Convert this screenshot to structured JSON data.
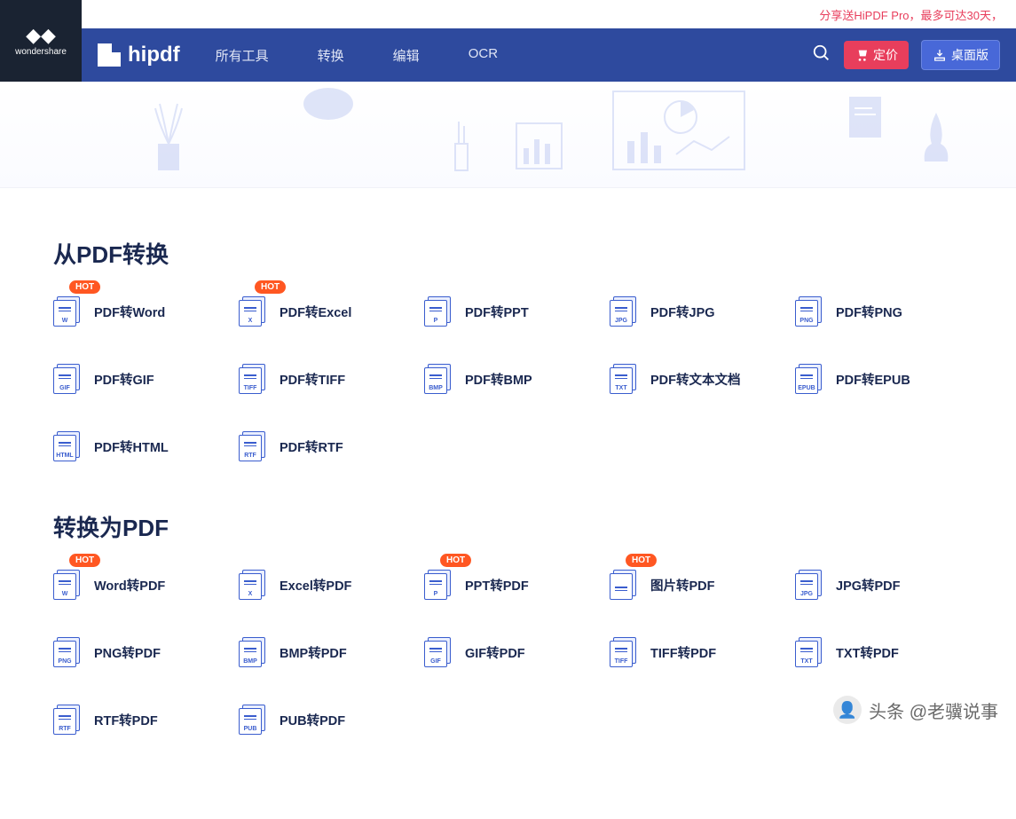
{
  "promo": "分享送HiPDF Pro，最多可达30天，",
  "brand": {
    "wondershare": "wondershare",
    "name": "hipdf"
  },
  "nav": {
    "links": [
      "所有工具",
      "转换",
      "编辑",
      "OCR"
    ],
    "pricing": "定价",
    "desktop": "桌面版"
  },
  "sections": [
    {
      "title": "从PDF转换",
      "tools": [
        {
          "label": "PDF转Word",
          "tag": "W",
          "hot": true
        },
        {
          "label": "PDF转Excel",
          "tag": "X",
          "hot": true
        },
        {
          "label": "PDF转PPT",
          "tag": "P",
          "hot": false
        },
        {
          "label": "PDF转JPG",
          "tag": "JPG",
          "hot": false
        },
        {
          "label": "PDF转PNG",
          "tag": "PNG",
          "hot": false
        },
        {
          "label": "PDF转GIF",
          "tag": "GIF",
          "hot": false
        },
        {
          "label": "PDF转TIFF",
          "tag": "TIFF",
          "hot": false
        },
        {
          "label": "PDF转BMP",
          "tag": "BMP",
          "hot": false
        },
        {
          "label": "PDF转文本文档",
          "tag": "TXT",
          "hot": false
        },
        {
          "label": "PDF转EPUB",
          "tag": "EPUB",
          "hot": false
        },
        {
          "label": "PDF转HTML",
          "tag": "HTML",
          "hot": false
        },
        {
          "label": "PDF转RTF",
          "tag": "RTF",
          "hot": false
        }
      ]
    },
    {
      "title": "转换为PDF",
      "tools": [
        {
          "label": "Word转PDF",
          "tag": "W",
          "hot": true
        },
        {
          "label": "Excel转PDF",
          "tag": "X",
          "hot": false
        },
        {
          "label": "PPT转PDF",
          "tag": "P",
          "hot": true
        },
        {
          "label": "图片转PDF",
          "tag": "",
          "hot": true
        },
        {
          "label": "JPG转PDF",
          "tag": "JPG",
          "hot": false
        },
        {
          "label": "PNG转PDF",
          "tag": "PNG",
          "hot": false
        },
        {
          "label": "BMP转PDF",
          "tag": "BMP",
          "hot": false
        },
        {
          "label": "GIF转PDF",
          "tag": "GIF",
          "hot": false
        },
        {
          "label": "TIFF转PDF",
          "tag": "TIFF",
          "hot": false
        },
        {
          "label": "TXT转PDF",
          "tag": "TXT",
          "hot": false
        },
        {
          "label": "RTF转PDF",
          "tag": "RTF",
          "hot": false
        },
        {
          "label": "PUB转PDF",
          "tag": "PUB",
          "hot": false
        }
      ]
    }
  ],
  "hot_label": "HOT",
  "watermark": "头条 @老骥说事"
}
